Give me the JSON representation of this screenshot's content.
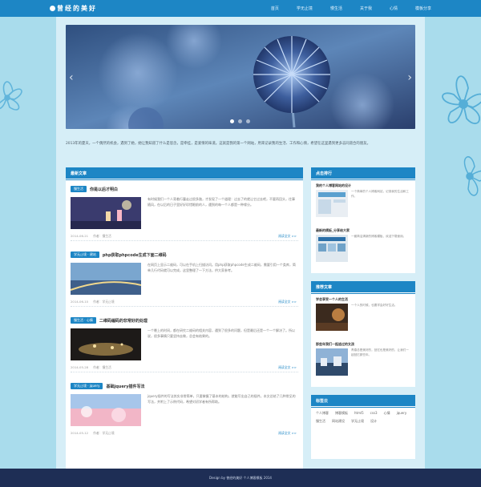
{
  "header": {
    "logo": "曾经的美好",
    "nav": [
      "首页",
      "学无止境",
      "慢生活",
      "关于我",
      "心情",
      "模板分享"
    ]
  },
  "banner": {
    "prev": "‹",
    "next": "›",
    "slides": 3,
    "active": 0
  },
  "intro": "2013年的夏天，一个偶然的机会，遇到了她，她让我知道了什么是思念，是牵挂，是爱情的味道。这就是我的第一个网站，用来记录我的生活、工作和心情，希望在这里遇到更多志同道合的朋友。",
  "main": {
    "title": "最新文章",
    "more_label": "阅读全文 >>",
    "posts": [
      {
        "category": "慢生活",
        "title": "你是以后才明白",
        "excerpt": "有时候我们一个人背着行囊走过很多路，才发现了一个道理：过去了的就让它过去吧，不要再回头，往事随风，在以后的日子里好好珍惜眼前的人，遇到的每一个人都是一种缘分。",
        "date": "2014-06-21",
        "author": "作者：慢生活"
      },
      {
        "category": "学无止境 · 建站",
        "title": "php获取phpcode生成下面二维码",
        "excerpt": "在网页上显示二维码，可以在手机上扫描访问。用php获取phpcode生成二维码，需要引用一个类库，简单几行代码就可以完成，这里整理了一下方法，供大家参考。",
        "date": "2014-06-10",
        "author": "作者：学无止境"
      },
      {
        "category": "慢生活 · 心情",
        "title": "二维码编码的非常好的处理",
        "excerpt": "一个晚上的时间，都在研究二维码的相关内容，遇到了很多的问题，但是最后还是一个一个解决了。所以说，很多事情只要坚持去做，总会有结果的。",
        "date": "2014-05-28",
        "author": "作者：慢生活"
      },
      {
        "category": "学无止境 · jquery",
        "title": "基础jquery插件写法",
        "excerpt": "jquery插件的写法其实非常简单，只要掌握了基本的结构，就能写出自己的插件。本文总结了几种常见的写法，并附上了示例代码，希望对初学者有所帮助。",
        "date": "2014-05-12",
        "author": "作者：学无止境"
      }
    ]
  },
  "sidebar": {
    "hot": {
      "title": "点击排行",
      "items": [
        {
          "title": "我的个人博客网站的设计",
          "text": "一个简单的个人博客网站，记录我的生活和工作。"
        },
        {
          "title": "最新的模板_分享给大家",
          "text": "一套简洁清新的博客模板，欢迎下载使用。"
        }
      ]
    },
    "recommend": {
      "title": "推荐文章",
      "items": [
        {
          "title": "学会享受一个人的生活",
          "text": "一个人的时候，也要学会好好生活。"
        },
        {
          "title": "那些年我们一起追过的女孩",
          "text": "青春总是美好的，回忆也是美好的，让我们一起回忆那些年。"
        }
      ]
    },
    "tags": {
      "title": "标签云",
      "items": [
        "个人博客",
        "博客模板",
        "html5",
        "css3",
        "心情",
        "jquery",
        "慢生活",
        "网站建设",
        "学无止境",
        "设计"
      ]
    }
  },
  "footer": "Design by 曾经的美好 个人博客模板 2014"
}
